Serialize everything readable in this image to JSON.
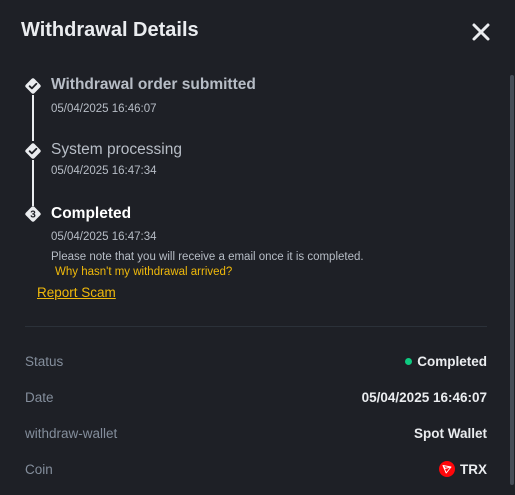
{
  "header": {
    "title": "Withdrawal Details",
    "close_icon": "close-icon"
  },
  "timeline": {
    "steps": [
      {
        "title": "Withdrawal order submitted",
        "time": "05/04/2025 16:46:07",
        "state": "done",
        "marker": "check"
      },
      {
        "title": "System processing",
        "time": "05/04/2025 16:47:34",
        "state": "done",
        "marker": "check"
      },
      {
        "title": "Completed",
        "time": "05/04/2025 16:47:34",
        "state": "current",
        "marker": "3"
      }
    ],
    "note": "Please note that you will receive a email once it is completed.",
    "help_link": "Why hasn't my withdrawal arrived?",
    "report_link": "Report Scam"
  },
  "details": {
    "rows": [
      {
        "label": "Status",
        "value": "Completed",
        "status_color": "#0ecb81"
      },
      {
        "label": "Date",
        "value": "05/04/2025 16:46:07"
      },
      {
        "label": "withdraw-wallet",
        "value": "Spot Wallet"
      },
      {
        "label": "Coin",
        "value": "TRX",
        "icon": "trx-coin-icon"
      }
    ]
  },
  "colors": {
    "background": "#1e2026",
    "accent": "#f0b90b",
    "success": "#0ecb81",
    "muted_text": "#848e9c",
    "trx_red": "#ff060a"
  }
}
